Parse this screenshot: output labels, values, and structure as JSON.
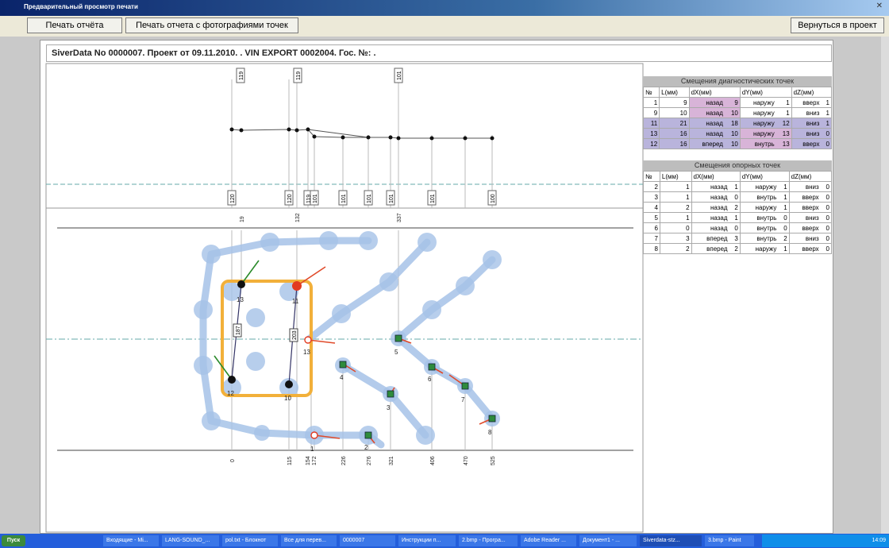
{
  "window": {
    "title": "Предварительный просмотр печати"
  },
  "toolbar": {
    "print_report": "Печать отчёта",
    "print_report_photos": "Печать отчета с фотографиями точек",
    "back_to_project": "Вернуться в проект"
  },
  "report": {
    "header": "SiverData No 0000007. Проект от 09.11.2010.    . VIN EXPORT 0002004. Гос. №: ."
  },
  "profile": {
    "top_labels": [
      "119",
      "119",
      "101"
    ],
    "bottom_labels": [
      "120",
      "120",
      "119",
      "101",
      "101",
      "101",
      "101",
      "101",
      "100"
    ]
  },
  "plan": {
    "top_ticks": [
      "19",
      "132",
      "337"
    ],
    "bottom_ticks": [
      "0",
      "115",
      "154",
      "172",
      "226",
      "276",
      "321",
      "406",
      "470",
      "525"
    ],
    "segment_labels": [
      "187",
      "203"
    ],
    "point_labels": [
      "13",
      "11",
      "13",
      "12",
      "10",
      "4",
      "5",
      "6",
      "3",
      "7",
      "8",
      "2",
      "1"
    ]
  },
  "diag_table": {
    "title": "Смещения диагностических точек",
    "headers": [
      "№",
      "L(мм)",
      "dX(мм)",
      "dY(мм)",
      "dZ(мм)"
    ],
    "rows": [
      {
        "n": "1",
        "l": "9",
        "dxd": "назад",
        "dx": "9",
        "dyd": "наружу",
        "dy": "1",
        "dzd": "вверх",
        "dz": "1"
      },
      {
        "n": "9",
        "l": "10",
        "dxd": "назад",
        "dx": "10",
        "dyd": "наружу",
        "dy": "1",
        "dzd": "вниз",
        "dz": "1"
      },
      {
        "n": "11",
        "l": "21",
        "dxd": "назад",
        "dx": "18",
        "dyd": "наружу",
        "dy": "12",
        "dzd": "вниз",
        "dz": "1"
      },
      {
        "n": "13",
        "l": "16",
        "dxd": "назад",
        "dx": "10",
        "dyd": "наружу",
        "dy": "13",
        "dzd": "вниз",
        "dz": "0"
      },
      {
        "n": "12",
        "l": "16",
        "dxd": "вперед",
        "dx": "10",
        "dyd": "внутрь",
        "dy": "13",
        "dzd": "вверх",
        "dz": "0"
      }
    ]
  },
  "ref_table": {
    "title": "Смещения опорных точек",
    "headers": [
      "№",
      "L(мм)",
      "dX(мм)",
      "dY(мм)",
      "dZ(мм)"
    ],
    "rows": [
      {
        "n": "2",
        "l": "1",
        "dxd": "назад",
        "dx": "1",
        "dyd": "наружу",
        "dy": "1",
        "dzd": "вниз",
        "dz": "0"
      },
      {
        "n": "3",
        "l": "1",
        "dxd": "назад",
        "dx": "0",
        "dyd": "внутрь",
        "dy": "1",
        "dzd": "вверх",
        "dz": "0"
      },
      {
        "n": "4",
        "l": "2",
        "dxd": "назад",
        "dx": "2",
        "dyd": "наружу",
        "dy": "1",
        "dzd": "вверх",
        "dz": "0"
      },
      {
        "n": "5",
        "l": "1",
        "dxd": "назад",
        "dx": "1",
        "dyd": "внутрь",
        "dy": "0",
        "dzd": "вниз",
        "dz": "0"
      },
      {
        "n": "6",
        "l": "0",
        "dxd": "назад",
        "dx": "0",
        "dyd": "внутрь",
        "dy": "0",
        "dzd": "вверх",
        "dz": "0"
      },
      {
        "n": "7",
        "l": "3",
        "dxd": "вперед",
        "dx": "3",
        "dyd": "внутрь",
        "dy": "2",
        "dzd": "вниз",
        "dz": "0"
      },
      {
        "n": "8",
        "l": "2",
        "dxd": "вперед",
        "dx": "2",
        "dyd": "наружу",
        "dy": "1",
        "dzd": "вверх",
        "dz": "0"
      }
    ]
  },
  "taskbar": {
    "start": "Пуск",
    "items": [
      "Входящие - Mi...",
      "LANG-SOUND_...",
      "pol.txt - Блокнот",
      "Все для перев...",
      "0000007",
      "Инструкции п...",
      "2.bmp - Програ...",
      "Adobe Reader ...",
      "Документ1 - ...",
      "Siverdata-stz...",
      "3.bmp - Paint"
    ],
    "clock": "14:09"
  }
}
